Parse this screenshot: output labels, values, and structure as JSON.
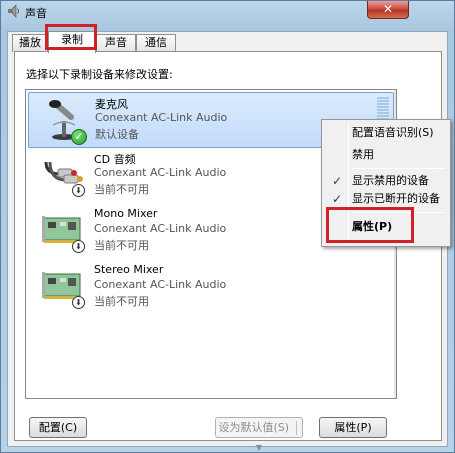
{
  "window": {
    "title": "声音",
    "close_glyph": "✕"
  },
  "tabs": [
    {
      "label": "播放"
    },
    {
      "label": "录制"
    },
    {
      "label": "声音"
    },
    {
      "label": "通信"
    }
  ],
  "instruction": "选择以下录制设备来修改设置:",
  "devices": [
    {
      "name": "麦克风",
      "driver": "Conexant AC-Link Audio",
      "status": "默认设备",
      "icon": "microphone-icon",
      "badge": "default-check-icon"
    },
    {
      "name": "CD 音频",
      "driver": "Conexant AC-Link Audio",
      "status": "当前不可用",
      "icon": "cd-audio-cable-icon",
      "badge": "down-arrow-icon"
    },
    {
      "name": "Mono Mixer",
      "driver": "Conexant AC-Link Audio",
      "status": "当前不可用",
      "icon": "sound-card-icon",
      "badge": "down-arrow-icon"
    },
    {
      "name": "Stereo Mixer",
      "driver": "Conexant AC-Link Audio",
      "status": "当前不可用",
      "icon": "sound-card-icon",
      "badge": "down-arrow-icon"
    }
  ],
  "context_menu": {
    "items": [
      {
        "label": "配置语音识别(S)",
        "checked": false
      },
      {
        "label": "禁用",
        "checked": false
      },
      {
        "label": "显示禁用的设备",
        "checked": true
      },
      {
        "label": "显示已断开的设备",
        "checked": true
      },
      {
        "label": "属性(P)",
        "checked": false,
        "bold": true
      }
    ],
    "check_glyph": "✓"
  },
  "buttons": {
    "configure": "配置(C)",
    "set_default": "设为默认值(S)",
    "set_default_arrow": "▼",
    "properties": "属性(P)"
  },
  "colors": {
    "highlight_box": "#d0202a",
    "selection": "#c1dbfc"
  }
}
